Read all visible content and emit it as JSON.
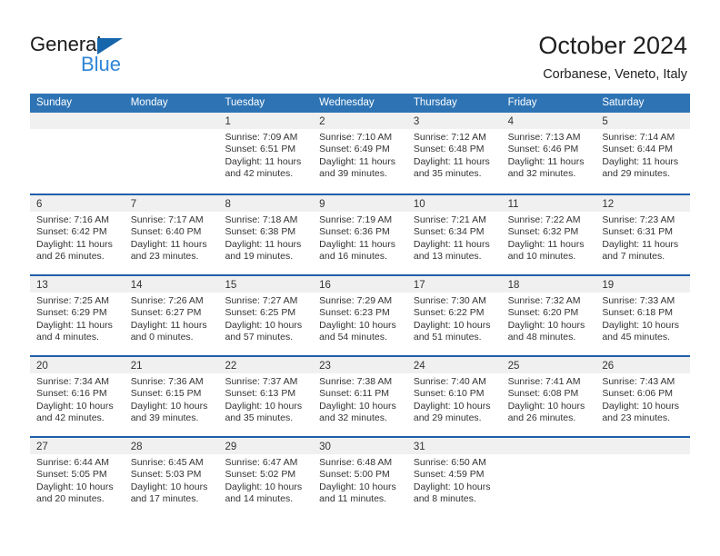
{
  "logo": {
    "word_one": "General",
    "word_two": "Blue",
    "triangle_color": "#1666ac",
    "blue_color": "#2f86d6"
  },
  "header": {
    "title": "October 2024",
    "subtitle": "Corbanese, Veneto, Italy"
  },
  "theme": {
    "header_blue": "#2e74b5",
    "separator_blue": "#1f5fa9",
    "day_band_gray": "#f0f0f0",
    "text": "#333333"
  },
  "weekdays": [
    "Sunday",
    "Monday",
    "Tuesday",
    "Wednesday",
    "Thursday",
    "Friday",
    "Saturday"
  ],
  "weeks": [
    [
      {
        "number": "",
        "lines": []
      },
      {
        "number": "",
        "lines": []
      },
      {
        "number": "1",
        "lines": [
          "Sunrise: 7:09 AM",
          "Sunset: 6:51 PM",
          "Daylight: 11 hours",
          "and 42 minutes."
        ]
      },
      {
        "number": "2",
        "lines": [
          "Sunrise: 7:10 AM",
          "Sunset: 6:49 PM",
          "Daylight: 11 hours",
          "and 39 minutes."
        ]
      },
      {
        "number": "3",
        "lines": [
          "Sunrise: 7:12 AM",
          "Sunset: 6:48 PM",
          "Daylight: 11 hours",
          "and 35 minutes."
        ]
      },
      {
        "number": "4",
        "lines": [
          "Sunrise: 7:13 AM",
          "Sunset: 6:46 PM",
          "Daylight: 11 hours",
          "and 32 minutes."
        ]
      },
      {
        "number": "5",
        "lines": [
          "Sunrise: 7:14 AM",
          "Sunset: 6:44 PM",
          "Daylight: 11 hours",
          "and 29 minutes."
        ]
      }
    ],
    [
      {
        "number": "6",
        "lines": [
          "Sunrise: 7:16 AM",
          "Sunset: 6:42 PM",
          "Daylight: 11 hours",
          "and 26 minutes."
        ]
      },
      {
        "number": "7",
        "lines": [
          "Sunrise: 7:17 AM",
          "Sunset: 6:40 PM",
          "Daylight: 11 hours",
          "and 23 minutes."
        ]
      },
      {
        "number": "8",
        "lines": [
          "Sunrise: 7:18 AM",
          "Sunset: 6:38 PM",
          "Daylight: 11 hours",
          "and 19 minutes."
        ]
      },
      {
        "number": "9",
        "lines": [
          "Sunrise: 7:19 AM",
          "Sunset: 6:36 PM",
          "Daylight: 11 hours",
          "and 16 minutes."
        ]
      },
      {
        "number": "10",
        "lines": [
          "Sunrise: 7:21 AM",
          "Sunset: 6:34 PM",
          "Daylight: 11 hours",
          "and 13 minutes."
        ]
      },
      {
        "number": "11",
        "lines": [
          "Sunrise: 7:22 AM",
          "Sunset: 6:32 PM",
          "Daylight: 11 hours",
          "and 10 minutes."
        ]
      },
      {
        "number": "12",
        "lines": [
          "Sunrise: 7:23 AM",
          "Sunset: 6:31 PM",
          "Daylight: 11 hours",
          "and 7 minutes."
        ]
      }
    ],
    [
      {
        "number": "13",
        "lines": [
          "Sunrise: 7:25 AM",
          "Sunset: 6:29 PM",
          "Daylight: 11 hours",
          "and 4 minutes."
        ]
      },
      {
        "number": "14",
        "lines": [
          "Sunrise: 7:26 AM",
          "Sunset: 6:27 PM",
          "Daylight: 11 hours",
          "and 0 minutes."
        ]
      },
      {
        "number": "15",
        "lines": [
          "Sunrise: 7:27 AM",
          "Sunset: 6:25 PM",
          "Daylight: 10 hours",
          "and 57 minutes."
        ]
      },
      {
        "number": "16",
        "lines": [
          "Sunrise: 7:29 AM",
          "Sunset: 6:23 PM",
          "Daylight: 10 hours",
          "and 54 minutes."
        ]
      },
      {
        "number": "17",
        "lines": [
          "Sunrise: 7:30 AM",
          "Sunset: 6:22 PM",
          "Daylight: 10 hours",
          "and 51 minutes."
        ]
      },
      {
        "number": "18",
        "lines": [
          "Sunrise: 7:32 AM",
          "Sunset: 6:20 PM",
          "Daylight: 10 hours",
          "and 48 minutes."
        ]
      },
      {
        "number": "19",
        "lines": [
          "Sunrise: 7:33 AM",
          "Sunset: 6:18 PM",
          "Daylight: 10 hours",
          "and 45 minutes."
        ]
      }
    ],
    [
      {
        "number": "20",
        "lines": [
          "Sunrise: 7:34 AM",
          "Sunset: 6:16 PM",
          "Daylight: 10 hours",
          "and 42 minutes."
        ]
      },
      {
        "number": "21",
        "lines": [
          "Sunrise: 7:36 AM",
          "Sunset: 6:15 PM",
          "Daylight: 10 hours",
          "and 39 minutes."
        ]
      },
      {
        "number": "22",
        "lines": [
          "Sunrise: 7:37 AM",
          "Sunset: 6:13 PM",
          "Daylight: 10 hours",
          "and 35 minutes."
        ]
      },
      {
        "number": "23",
        "lines": [
          "Sunrise: 7:38 AM",
          "Sunset: 6:11 PM",
          "Daylight: 10 hours",
          "and 32 minutes."
        ]
      },
      {
        "number": "24",
        "lines": [
          "Sunrise: 7:40 AM",
          "Sunset: 6:10 PM",
          "Daylight: 10 hours",
          "and 29 minutes."
        ]
      },
      {
        "number": "25",
        "lines": [
          "Sunrise: 7:41 AM",
          "Sunset: 6:08 PM",
          "Daylight: 10 hours",
          "and 26 minutes."
        ]
      },
      {
        "number": "26",
        "lines": [
          "Sunrise: 7:43 AM",
          "Sunset: 6:06 PM",
          "Daylight: 10 hours",
          "and 23 minutes."
        ]
      }
    ],
    [
      {
        "number": "27",
        "lines": [
          "Sunrise: 6:44 AM",
          "Sunset: 5:05 PM",
          "Daylight: 10 hours",
          "and 20 minutes."
        ]
      },
      {
        "number": "28",
        "lines": [
          "Sunrise: 6:45 AM",
          "Sunset: 5:03 PM",
          "Daylight: 10 hours",
          "and 17 minutes."
        ]
      },
      {
        "number": "29",
        "lines": [
          "Sunrise: 6:47 AM",
          "Sunset: 5:02 PM",
          "Daylight: 10 hours",
          "and 14 minutes."
        ]
      },
      {
        "number": "30",
        "lines": [
          "Sunrise: 6:48 AM",
          "Sunset: 5:00 PM",
          "Daylight: 10 hours",
          "and 11 minutes."
        ]
      },
      {
        "number": "31",
        "lines": [
          "Sunrise: 6:50 AM",
          "Sunset: 4:59 PM",
          "Daylight: 10 hours",
          "and 8 minutes."
        ]
      },
      {
        "number": "",
        "lines": []
      },
      {
        "number": "",
        "lines": []
      }
    ]
  ]
}
